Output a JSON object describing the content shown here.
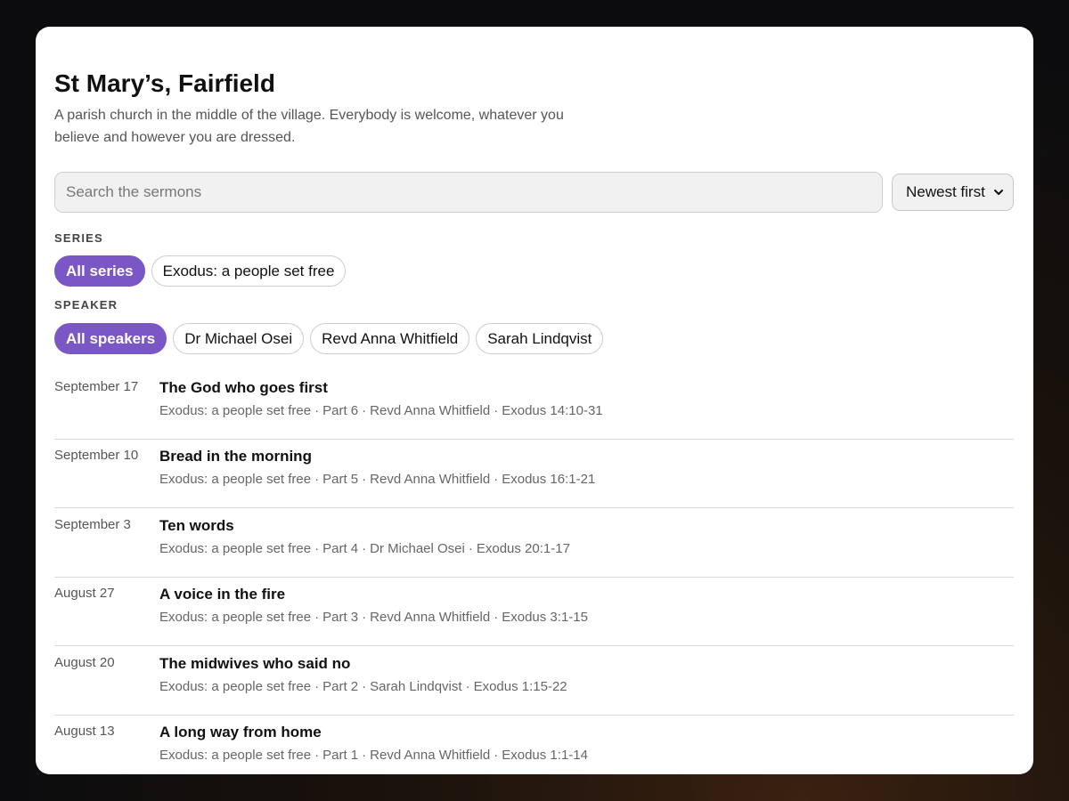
{
  "church": {
    "title": "St Mary’s, Fairfield",
    "description": "A parish church in the middle of the village. Everybody is welcome, whatever you believe and however you are dressed."
  },
  "search": {
    "placeholder": "Search the sermons",
    "value": ""
  },
  "sort": {
    "selected": "Newest first"
  },
  "filters": {
    "series_label": "SERIES",
    "series": [
      {
        "label": "All series",
        "active": true
      },
      {
        "label": "Exodus: a people set free",
        "active": false
      }
    ],
    "speaker_label": "SPEAKER",
    "speakers": [
      {
        "label": "All speakers",
        "active": true
      },
      {
        "label": "Dr Michael Osei",
        "active": false
      },
      {
        "label": "Revd Anna Whitfield",
        "active": false
      },
      {
        "label": "Sarah Lindqvist",
        "active": false
      }
    ]
  },
  "sermons": [
    {
      "date": "September 17",
      "title": "The God who goes first",
      "series": "Exodus: a people set free",
      "part": "Part 6",
      "speaker": "Revd Anna Whitfield",
      "passage": "Exodus 14:10-31"
    },
    {
      "date": "September 10",
      "title": "Bread in the morning",
      "series": "Exodus: a people set free",
      "part": "Part 5",
      "speaker": "Revd Anna Whitfield",
      "passage": "Exodus 16:1-21"
    },
    {
      "date": "September 3",
      "title": "Ten words",
      "series": "Exodus: a people set free",
      "part": "Part 4",
      "speaker": "Dr Michael Osei",
      "passage": "Exodus 20:1-17"
    },
    {
      "date": "August 27",
      "title": "A voice in the fire",
      "series": "Exodus: a people set free",
      "part": "Part 3",
      "speaker": "Revd Anna Whitfield",
      "passage": "Exodus 3:1-15"
    },
    {
      "date": "August 20",
      "title": "The midwives who said no",
      "series": "Exodus: a people set free",
      "part": "Part 2",
      "speaker": "Sarah Lindqvist",
      "passage": "Exodus 1:15-22"
    },
    {
      "date": "August 13",
      "title": "A long way from home",
      "series": "Exodus: a people set free",
      "part": "Part 1",
      "speaker": "Revd Anna Whitfield",
      "passage": "Exodus 1:1-14"
    }
  ],
  "meta_separator": "·",
  "colors": {
    "accent": "#7b57c6",
    "card": "#ffffff",
    "background": "#0c0c0e"
  },
  "icons": {
    "sort_arrow": "chevron-down-icon"
  }
}
